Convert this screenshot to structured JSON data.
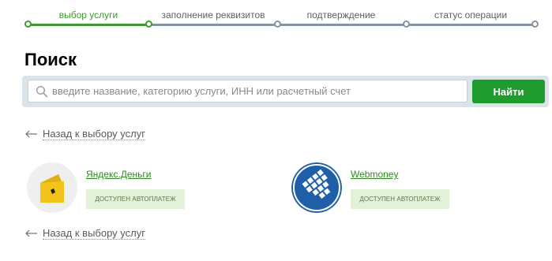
{
  "steps": [
    {
      "label": "выбор услуги",
      "state": "done"
    },
    {
      "label": "заполнение реквизитов",
      "state": "todo"
    },
    {
      "label": "подтверждение",
      "state": "todo"
    },
    {
      "label": "статус операции",
      "state": "todo"
    }
  ],
  "colors": {
    "accent": "#3d9a2e",
    "button": "#1f9c2d",
    "inactive_track": "#8693a0",
    "search_bar_bg": "#dbe4e8",
    "badge_bg": "#e3f1d8"
  },
  "page": {
    "title": "Поиск"
  },
  "search": {
    "placeholder": "введите название, категорию услуги, ИНН или расчетный счет",
    "value": "",
    "button_label": "Найти",
    "icon": "search-icon"
  },
  "back_link": {
    "label": "Назад к выбору услуг",
    "icon": "arrow-left-icon"
  },
  "providers": [
    {
      "name": "Яндекс.Деньги",
      "badge": "доступен автоплатеж",
      "logo": "yandex-money-logo"
    },
    {
      "name": "Webmoney",
      "badge": "доступен автоплатеж",
      "logo": "webmoney-logo"
    }
  ]
}
